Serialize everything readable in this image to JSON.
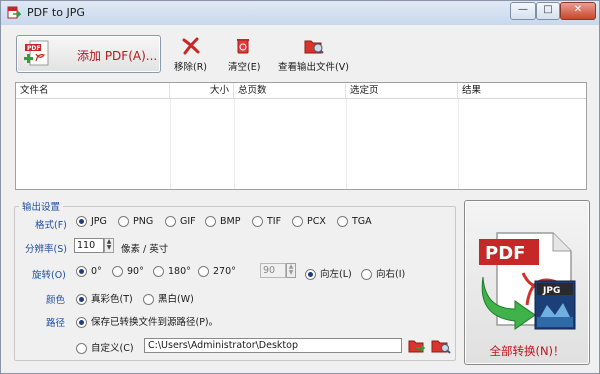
{
  "window": {
    "title": "PDF to JPG",
    "minimize": "—",
    "maximize": "□",
    "close": "✕"
  },
  "toolbar": {
    "add_pdf": "添加 PDF(A)...",
    "remove": "移除(R)",
    "clear": "清空(E)",
    "view_output": "查看输出文件(V)"
  },
  "filelist": {
    "columns": [
      "文件名",
      "大小",
      "总页数",
      "选定页",
      "结果"
    ]
  },
  "output": {
    "legend": "输出设置",
    "format": {
      "label": "格式(F)",
      "options": [
        "JPG",
        "PNG",
        "GIF",
        "BMP",
        "TIF",
        "PCX",
        "TGA"
      ],
      "selected": "JPG"
    },
    "resolution": {
      "label": "分辨率(S)",
      "value": "110",
      "unit": "像素 / 英寸"
    },
    "rotation": {
      "label": "旋转(O)",
      "options": [
        "0°",
        "90°",
        "180°",
        "270°"
      ],
      "selected": "0°",
      "custom_value": "90",
      "direction_options": [
        "向左(L)",
        "向右(I)"
      ],
      "direction_selected": "向左(L)"
    },
    "color": {
      "label": "颜色",
      "options": [
        "真彩色(T)",
        "黑白(W)"
      ],
      "selected": "真彩色(T)"
    },
    "path": {
      "label": "路径",
      "source_option": "保存已转换文件到源路径(P)。",
      "custom_option": "自定义(C)",
      "custom_value": "C:\\Users\\Administrator\\Desktop",
      "selected": "source"
    }
  },
  "convert_all": {
    "label": "全部转换(N)！",
    "pdf_badge": "PDF",
    "jpg_badge": "JPG"
  },
  "colors": {
    "accent_red": "#c0141a",
    "label_blue": "#1e4fa0"
  }
}
